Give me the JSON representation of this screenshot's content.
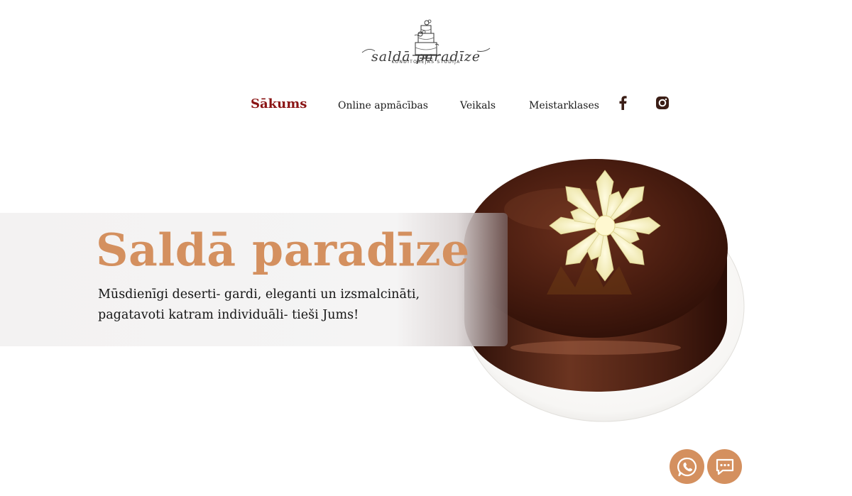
{
  "logo": {
    "script_text": "saldā paradīze",
    "subtitle": "KONDITOREJAS STUDIJA"
  },
  "nav": {
    "items": [
      {
        "label": "Sākums",
        "active": true
      },
      {
        "label": "Online apmācības",
        "active": false
      },
      {
        "label": "Veikals",
        "active": false
      },
      {
        "label": "Meistarklases",
        "active": false
      }
    ],
    "social": [
      "facebook-icon",
      "instagram-icon"
    ]
  },
  "hero": {
    "title": "Saldā paradīze",
    "text": "Mūsdienīgi deserti- gardi, eleganti un izsmalcināti, pagatavoti katram individuāli- tieši Jums!",
    "image": "chocolate-mirror-glaze-cake-with-white-flower"
  },
  "floating_buttons": [
    "whatsapp-icon",
    "chat-icon"
  ],
  "colors": {
    "accent": "#d4905f",
    "nav_active": "#8a1414",
    "text": "#151515",
    "panel": "#f4f3f3",
    "glaze": "#4a1f14"
  }
}
